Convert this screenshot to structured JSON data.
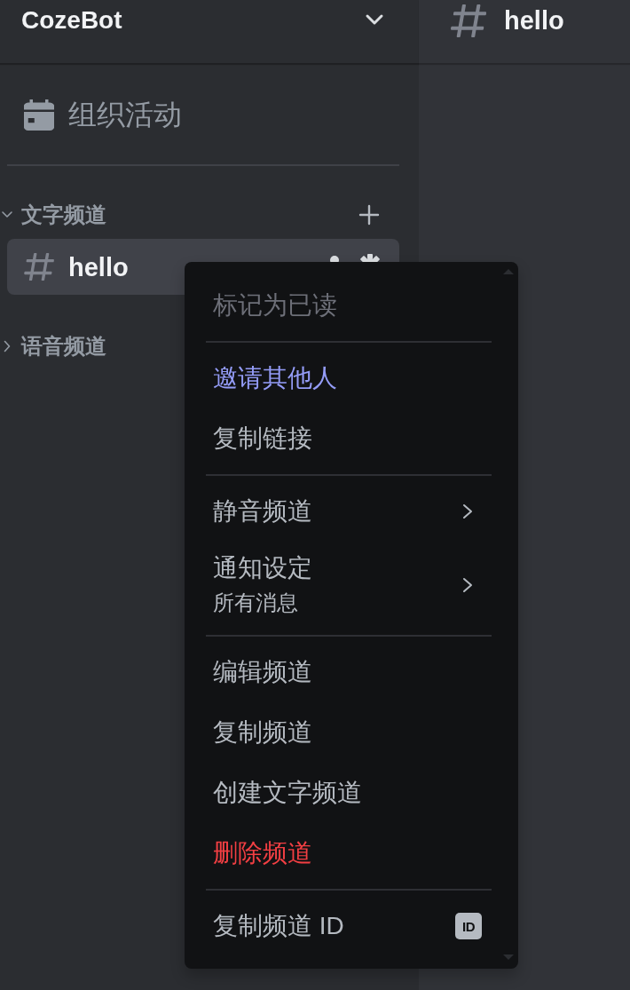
{
  "sidebar": {
    "server_name": "CozeBot",
    "events_label": "组织活动",
    "categories": [
      {
        "name": "文字频道",
        "expanded": true,
        "channels": [
          {
            "name": "hello",
            "selected": true
          }
        ]
      },
      {
        "name": "语音频道",
        "expanded": false
      }
    ]
  },
  "channel_header": {
    "name": "hello"
  },
  "context_menu": {
    "groups": [
      {
        "items": [
          {
            "label": "标记为已读",
            "kind": "plain",
            "accent": false,
            "danger": false,
            "disabled": true
          }
        ]
      },
      {
        "items": [
          {
            "label": "邀请其他人",
            "kind": "plain",
            "accent": true,
            "danger": false,
            "disabled": false
          },
          {
            "label": "复制链接",
            "kind": "plain",
            "accent": false,
            "danger": false,
            "disabled": false
          }
        ]
      },
      {
        "items": [
          {
            "label": "静音频道",
            "kind": "submenu",
            "accent": false,
            "danger": false,
            "disabled": false
          },
          {
            "label": "通知设定",
            "subtitle": "所有消息",
            "kind": "submenu",
            "accent": false,
            "danger": false,
            "disabled": false
          }
        ]
      },
      {
        "items": [
          {
            "label": "编辑频道",
            "kind": "plain",
            "accent": false,
            "danger": false,
            "disabled": false
          },
          {
            "label": "复制频道",
            "kind": "plain",
            "accent": false,
            "danger": false,
            "disabled": false
          },
          {
            "label": "创建文字频道",
            "kind": "plain",
            "accent": false,
            "danger": false,
            "disabled": false
          },
          {
            "label": "删除频道",
            "kind": "plain",
            "accent": false,
            "danger": true,
            "disabled": false
          }
        ]
      },
      {
        "items": [
          {
            "label": "复制频道 ID",
            "kind": "badge",
            "badge": "ID",
            "accent": false,
            "danger": false,
            "disabled": false
          }
        ]
      }
    ]
  }
}
